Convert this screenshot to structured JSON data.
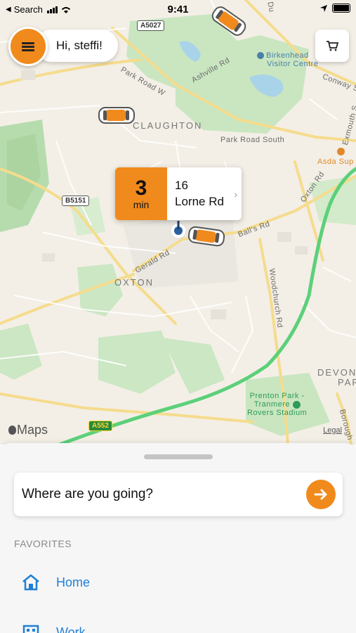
{
  "status_bar": {
    "back_label": "Search",
    "time": "9:41"
  },
  "header": {
    "greeting": "Hi, steffi!"
  },
  "map": {
    "districts": {
      "claughton": "CLAUGHTON",
      "oxton": "OXTON",
      "devonshire": "DEVONS",
      "devonshire_line2": "PAR"
    },
    "roads": {
      "a5027": "A5027",
      "b5151": "B5151",
      "a552": "A552",
      "ashville": "Ashville Rd",
      "park_road_w": "Park Road W",
      "park_road_south": "Park Road South",
      "conway": "Conway S",
      "exmouth": "Exmouth S",
      "oxton_rd": "Oxton Rd",
      "balls_rd": "Ball's Rd",
      "gerald_rd": "Gerald Rd",
      "woodchurch_rd": "Woodchurch Rd",
      "borough": "Borough",
      "du": "Du"
    },
    "pois": {
      "birkenhead_line1": "Birkenhead",
      "birkenhead_line2": "Visitor Centre",
      "asda": "Asda Sup",
      "prenton_line1": "Prenton Park -",
      "prenton_line2": "Tranmere",
      "prenton_line3": "Rovers Stadium"
    },
    "attribution": "Maps",
    "legal": "Legal"
  },
  "eta": {
    "minutes": "3",
    "unit": "min",
    "house_number": "16",
    "street": "Lorne Rd"
  },
  "sheet": {
    "search_placeholder": "Where are you going?",
    "favorites_header": "FAVORITES",
    "favorites": [
      {
        "label": "Home",
        "icon": "home-icon"
      },
      {
        "label": "Work",
        "icon": "work-icon"
      }
    ]
  },
  "colors": {
    "accent": "#f08a1c",
    "link": "#1f7fd6",
    "park": "#c8e6c0",
    "route": "#5cd07a"
  }
}
